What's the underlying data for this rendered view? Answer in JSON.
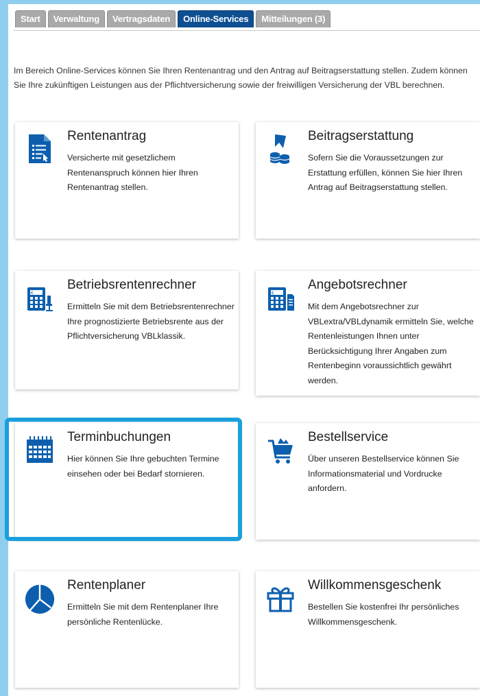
{
  "tabs": [
    {
      "label": "Start"
    },
    {
      "label": "Verwaltung"
    },
    {
      "label": "Vertragsdaten"
    },
    {
      "label": "Online-Services"
    },
    {
      "label": "Mitteilungen (3)"
    }
  ],
  "intro": "Im Bereich Online-Services können Sie Ihren Rentenantrag und den Antrag auf Beitragserstattung stellen. Zudem können Sie Ihre zukünftigen Leistungen aus der Pflichtversicherung sowie der freiwilligen Versicherung der VBL berechnen.",
  "colors": {
    "accent": "#0d5fae",
    "active_tab": "#0d4f91",
    "highlight": "#1a9fdd"
  },
  "cards": [
    {
      "title": "Rentenantrag",
      "description": "Versicherte mit gesetzlichem Rentenanspruch können hier Ihren Rentenantrag stellen.",
      "icon": "document-form-icon"
    },
    {
      "title": "Beitragserstattung",
      "description": "Sofern Sie die Voraussetzungen zur Erstattung erfüllen, können Sie hier Ihren Antrag auf Beitragserstattung stellen.",
      "icon": "coins-refund-icon"
    },
    {
      "title": "Betriebsrentenrechner",
      "description": "Ermitteln Sie mit dem Betriebsrentenrechner Ihre prognostizierte Betriebsrente aus der Pflichtversicherung VBLklassik.",
      "icon": "calculator-chair-icon"
    },
    {
      "title": "Angebotsrechner",
      "description": "Mit dem Angebotsrechner zur VBLextra/VBLdynamik ermitteln Sie, welche Rentenleistungen Ihnen unter Berücksichtigung Ihrer Angaben zum Rentenbeginn voraussichtlich gewährt werden.",
      "icon": "calculator-document-icon"
    },
    {
      "title": "Terminbuchungen",
      "description": "Hier können Sie Ihre gebuchten Termine einsehen oder bei Bedarf stornieren.",
      "icon": "calendar-icon"
    },
    {
      "title": "Bestellservice",
      "description": "Über unseren Bestellservice können Sie Informationsmaterial und Vordrucke anfordern.",
      "icon": "shopping-cart-icon"
    },
    {
      "title": "Rentenplaner",
      "description": "Ermitteln Sie mit dem Rentenplaner Ihre persönliche Rentenlücke.",
      "icon": "pie-chart-icon"
    },
    {
      "title": "Willkommensgeschenk",
      "description": "Bestellen Sie kostenfrei Ihr persönliches Willkommensgeschenk.",
      "icon": "gift-icon"
    }
  ]
}
